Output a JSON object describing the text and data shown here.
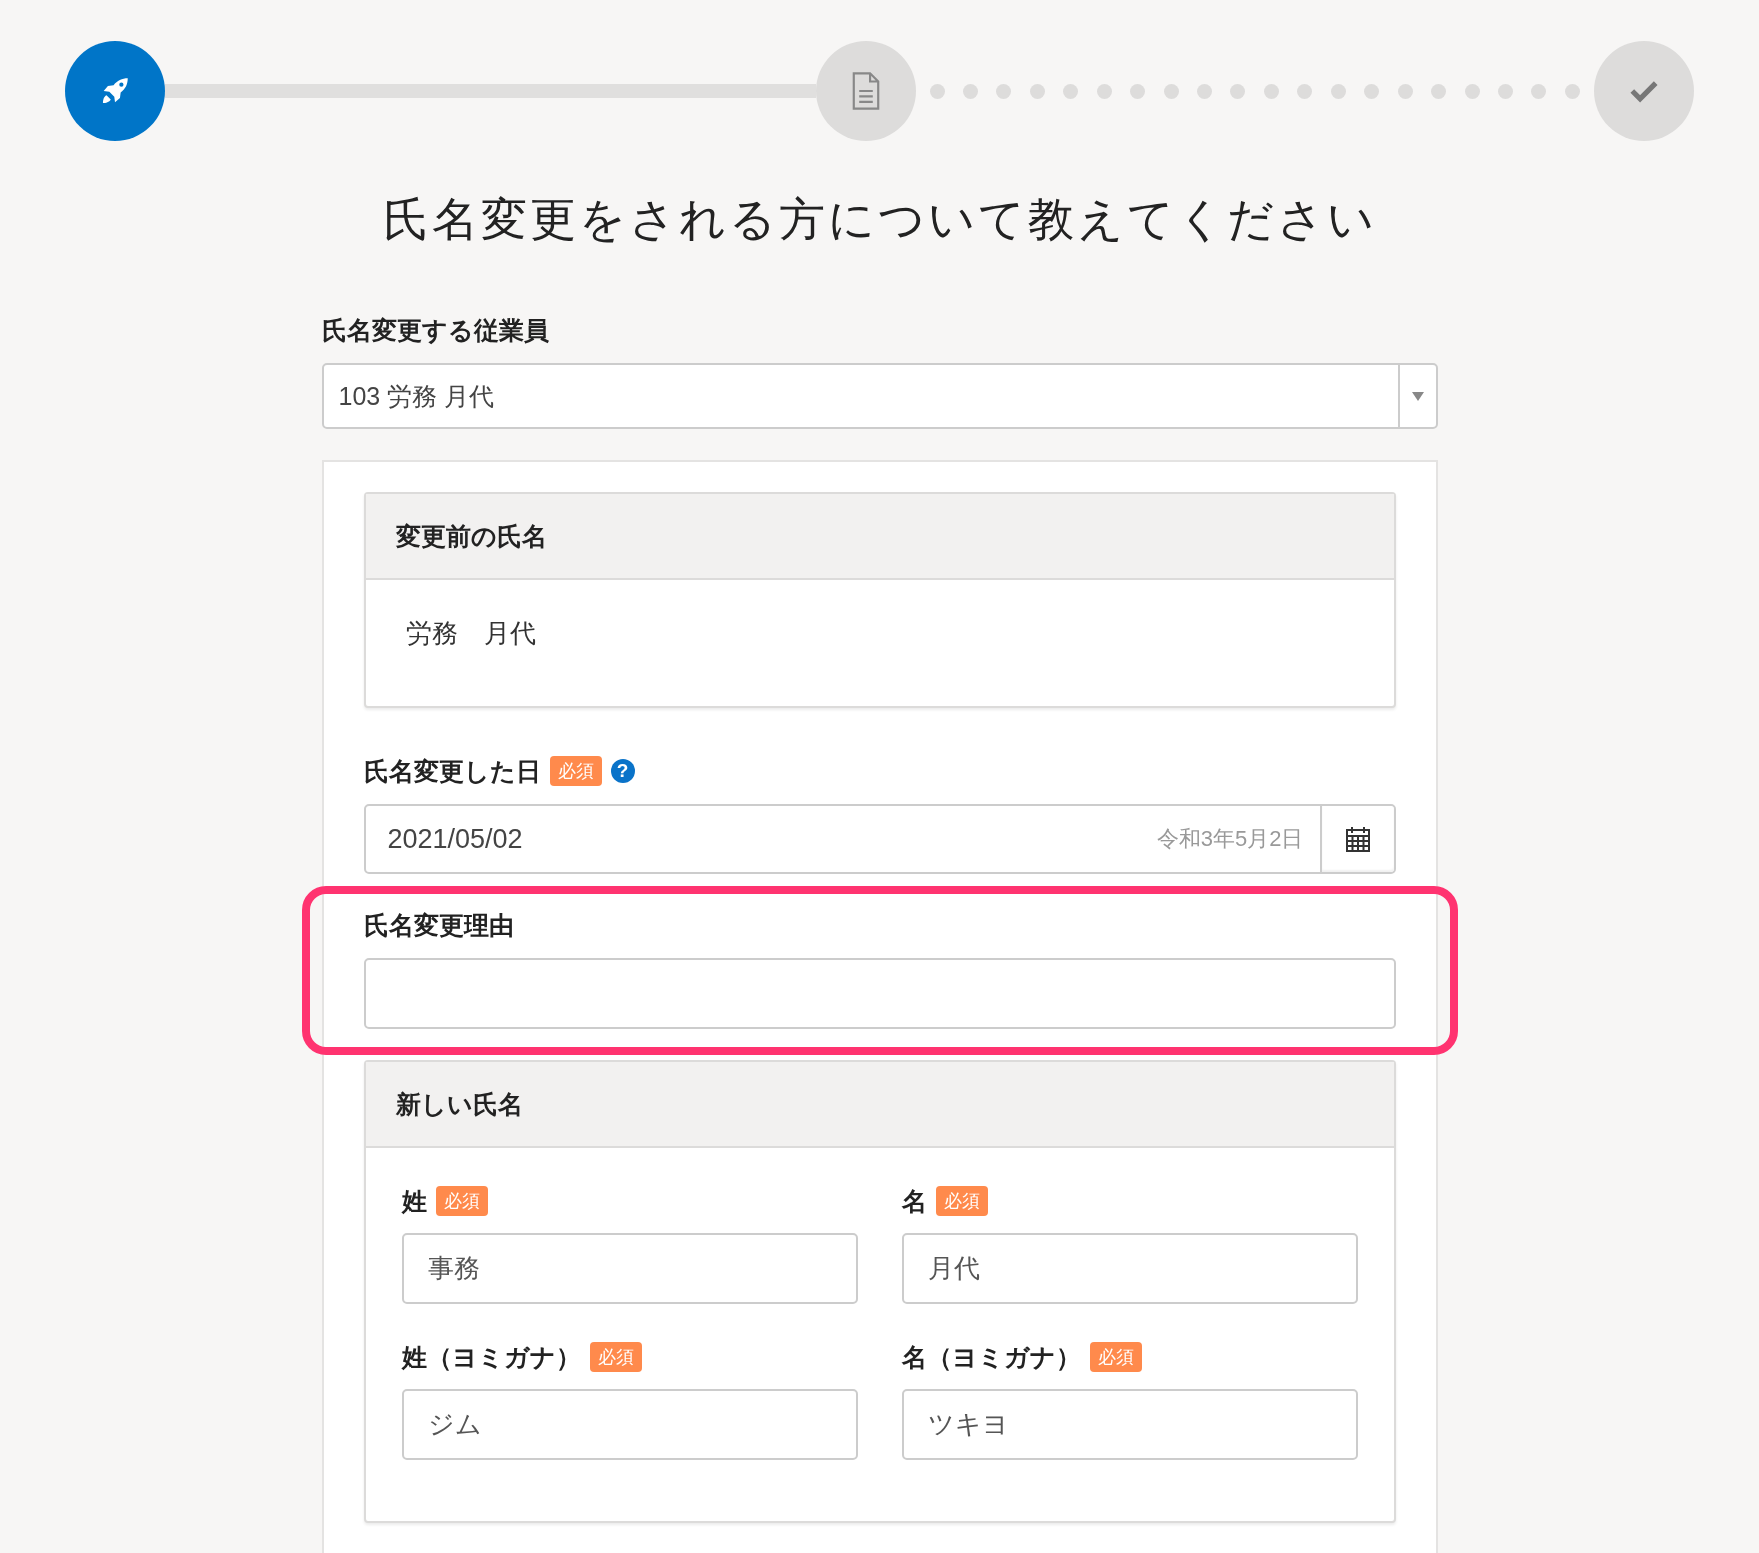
{
  "stepper": {
    "steps": [
      {
        "selected": true
      },
      {
        "selected": false
      },
      {
        "selected": false
      }
    ]
  },
  "title": "氏名変更をされる方について教えてください",
  "employee_select": {
    "label": "氏名変更する従業員",
    "value": "103 労務 月代"
  },
  "previous_name": {
    "heading": "変更前の氏名",
    "value": "労務　月代"
  },
  "change_date": {
    "label": "氏名変更した日",
    "badge": "必須",
    "help_mark": "?",
    "value": "2021/05/02",
    "era_date": "令和3年5月2日"
  },
  "reason": {
    "label": "氏名変更理由",
    "highlighted": true
  },
  "new_name": {
    "heading": "新しい氏名",
    "fields": [
      {
        "label": "姓",
        "badge": "必須",
        "value": "事務"
      },
      {
        "label": "名",
        "badge": "必須",
        "value": "月代"
      },
      {
        "label": "姓（ヨミガナ）",
        "badge": "必須",
        "value": "ジム"
      },
      {
        "label": "名（ヨミガナ）",
        "badge": "必須",
        "value": "ツキヨ"
      }
    ]
  }
}
